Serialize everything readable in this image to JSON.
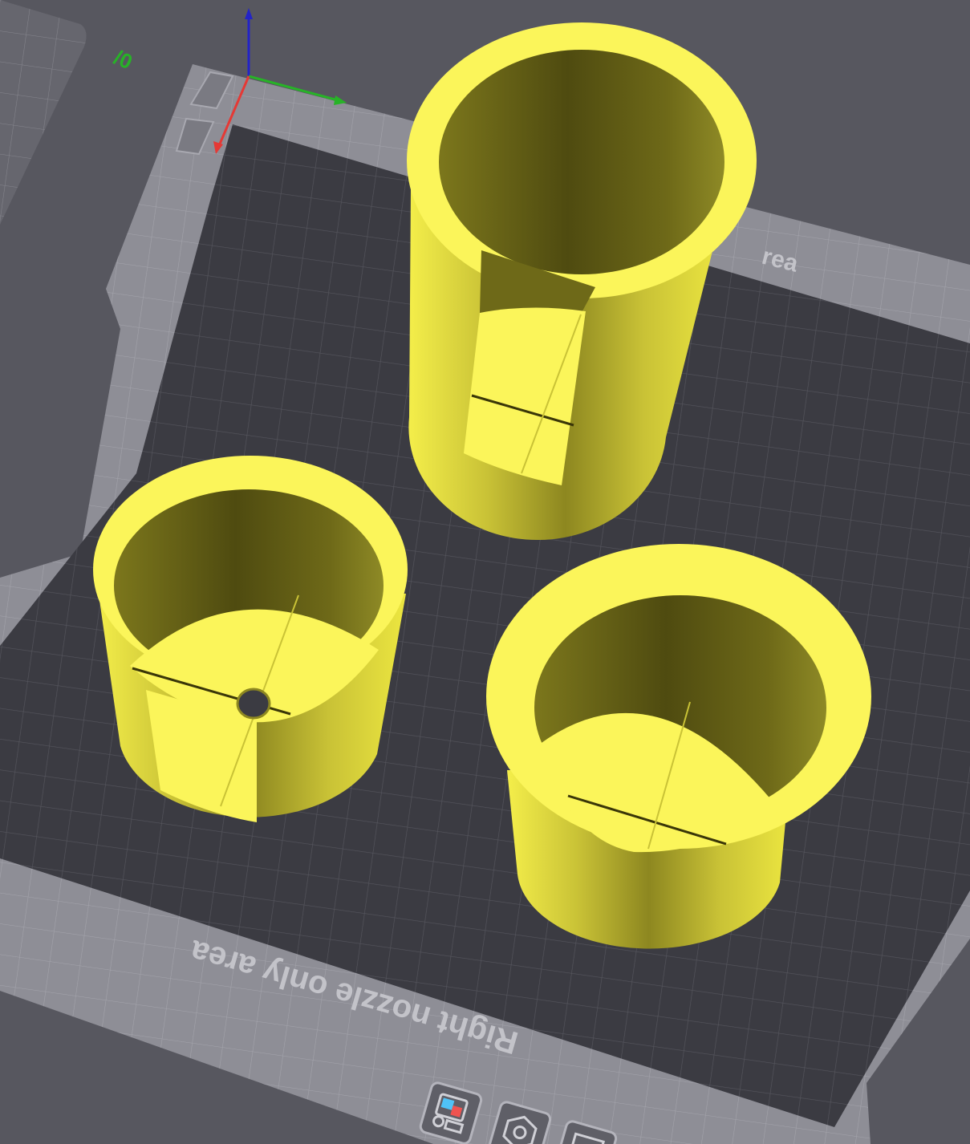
{
  "bed": {
    "label_bottom": "Right nozzle only area",
    "label_top_partial": "rea",
    "plate_number": "/0"
  },
  "colors": {
    "background": "#57575f",
    "bed_border": "#8e8e96",
    "print_area": "#3b3b42",
    "grid_line": "#55555d",
    "model_rim": "#fbf55a",
    "model_shadow": "#55500f",
    "axis_x": "#e53935",
    "axis_y": "#27b327",
    "axis_z": "#2323c8"
  },
  "toolbar": {
    "buttons": [
      {
        "name": "plate-settings",
        "icon": "plate-settings-icon"
      },
      {
        "name": "auto-orient",
        "icon": "hexagon-nut-icon"
      },
      {
        "name": "arrange",
        "icon": "arrange-icon"
      }
    ]
  },
  "models": [
    {
      "name": "tall-cylinder-with-slot"
    },
    {
      "name": "short-cylinder-with-slot-and-hole"
    },
    {
      "name": "flanged-cylinder"
    }
  ]
}
